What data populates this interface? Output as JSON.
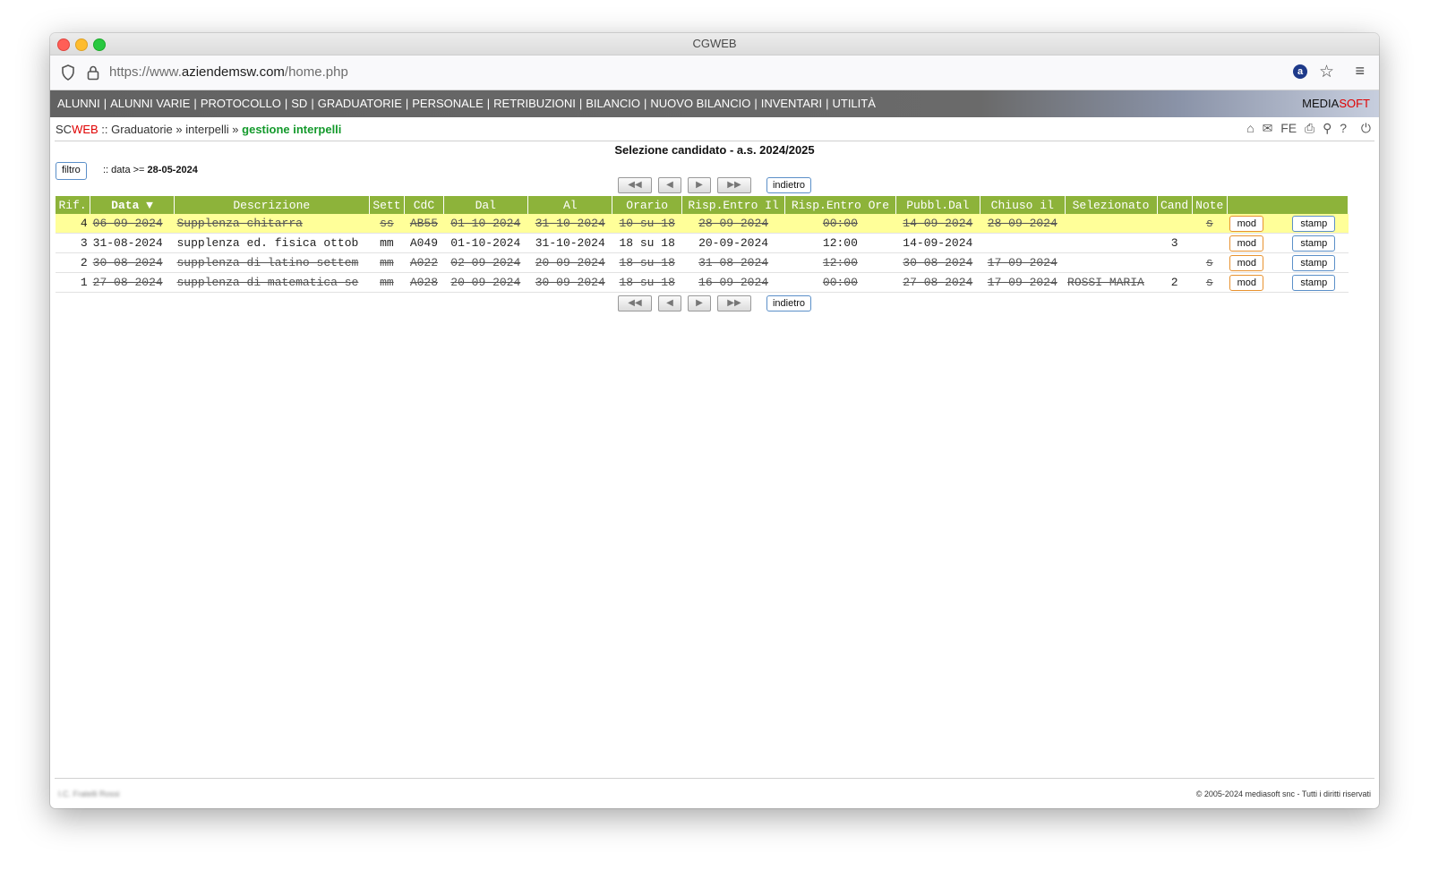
{
  "window": {
    "title": "CGWEB"
  },
  "browser": {
    "url_prefix": "https://www.",
    "url_domain": "aziendemsw.com",
    "url_path": "/home.php"
  },
  "nav": {
    "items": [
      "ALUNNI",
      "ALUNNI VARIE",
      "PROTOCOLLO",
      "SD",
      "GRADUATORIE",
      "PERSONALE",
      "RETRIBUZIONI",
      "BILANCIO",
      "NUOVO BILANCIO",
      "INVENTARI",
      "UTILITÀ"
    ],
    "brand_a": "MEDIA",
    "brand_b": "SOFT"
  },
  "breadcrumb": {
    "app_a": "SC",
    "app_b": "WEB",
    "sep1": " :: ",
    "level1": "Graduatorie",
    "sep2": " » ",
    "level2": "interpelli",
    "sep3": " » ",
    "current": "gestione interpelli"
  },
  "toolbar": {
    "fe_label": "FE"
  },
  "page": {
    "title": "Selezione candidato - a.s. 2024/2025",
    "filter_button": "filtro",
    "filter_prefix": ":: data >= ",
    "filter_value": "28-05-2024",
    "back_label": "indietro"
  },
  "table": {
    "headers": [
      "Rif.",
      "Data ▼",
      "Descrizione",
      "Sett",
      "CdC",
      "Dal",
      "Al",
      "Orario",
      "Risp.Entro Il",
      "Risp.Entro Ore",
      "Pubbl.Dal",
      "Chiuso il",
      "Selezionato",
      "Cand",
      "Note",
      ""
    ],
    "mod_label": "mod",
    "stamp_label": "stamp",
    "rows": [
      {
        "rif": "4",
        "data": "06-09-2024",
        "descrizione": "Supplenza chitarra",
        "sett": "ss",
        "cdc": "AB55",
        "dal": "01-10-2024",
        "al": "31-10-2024",
        "orario": "10 su 18",
        "risp_il": "28-09-2024",
        "risp_ore": "00:00",
        "pubbl": "14-09-2024",
        "chiuso": "28-09-2024",
        "selezionato": "",
        "cand": "",
        "note": "s"
      },
      {
        "rif": "3",
        "data": "31-08-2024",
        "descrizione": "supplenza ed. fisica ottob",
        "sett": "mm",
        "cdc": "A049",
        "dal": "01-10-2024",
        "al": "31-10-2024",
        "orario": "18 su 18",
        "risp_il": "20-09-2024",
        "risp_ore": "12:00",
        "pubbl": "14-09-2024",
        "chiuso": "",
        "selezionato": "",
        "cand": "3",
        "note": ""
      },
      {
        "rif": "2",
        "data": "30-08-2024",
        "descrizione": "supplenza di latino settem",
        "sett": "mm",
        "cdc": "A022",
        "dal": "02-09-2024",
        "al": "20-09-2024",
        "orario": "18 su 18",
        "risp_il": "31-08-2024",
        "risp_ore": "12:00",
        "pubbl": "30-08-2024",
        "chiuso": "17-09-2024",
        "selezionato": "",
        "cand": "",
        "note": "s"
      },
      {
        "rif": "1",
        "data": "27-08-2024",
        "descrizione": "supplenza di matematica se",
        "sett": "mm",
        "cdc": "A028",
        "dal": "20-09-2024",
        "al": "30-09-2024",
        "orario": "18 su 18",
        "risp_il": "16-09-2024",
        "risp_ore": "00:00",
        "pubbl": "27-08-2024",
        "chiuso": "17-09-2024",
        "selezionato": "ROSSI MARIA",
        "cand": "2",
        "note": "s"
      }
    ]
  },
  "footer": {
    "left": "I.C. Fratelli Rossi",
    "right": "© 2005-2024 mediasoft snc - Tutti i diritti riservati"
  },
  "colors": {
    "header_green": "#8db33a",
    "highlight_row": "#ffff99",
    "brand_red": "#e00000",
    "crumb_green": "#149a2c"
  }
}
